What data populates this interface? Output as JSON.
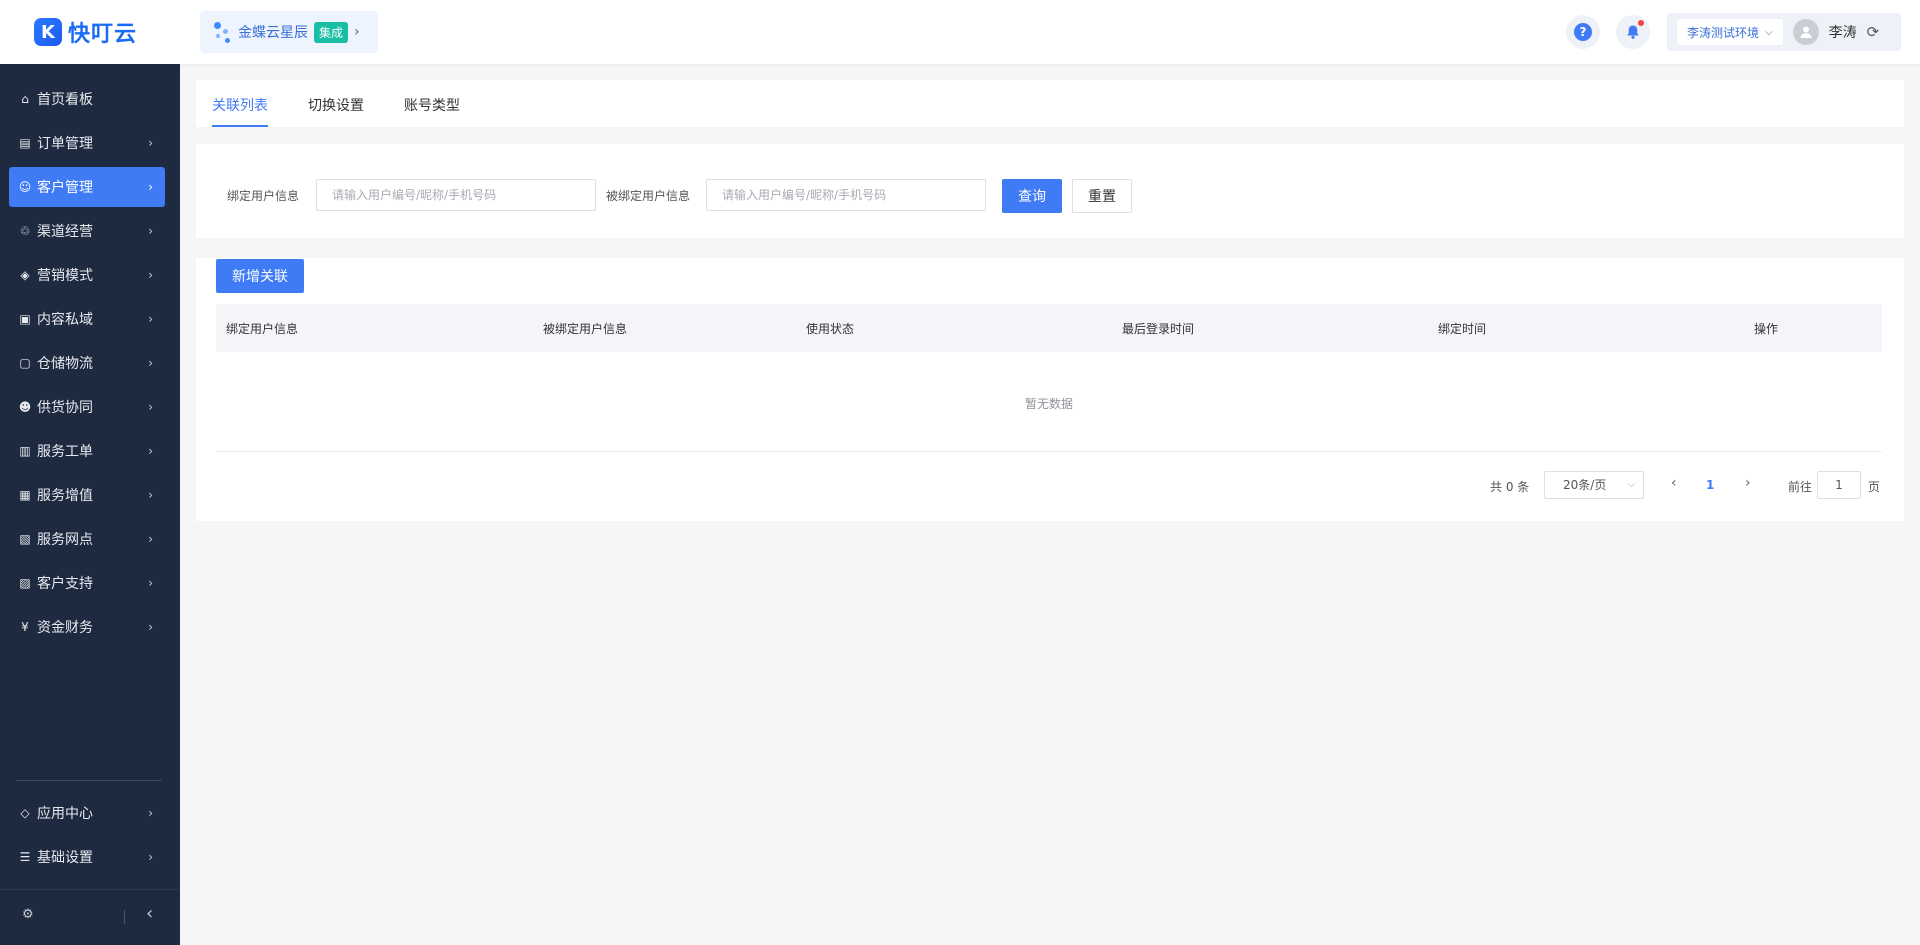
{
  "header": {
    "logo_mark": "K",
    "logo_text": "快叮云",
    "product_name": "金蝶云星辰",
    "product_badge": "集成",
    "help_glyph": "?",
    "env_name": "李涛测试环境",
    "user_name": "李涛"
  },
  "sidebar": {
    "items": [
      {
        "label": "首页看板",
        "icon": "home-icon",
        "glyph": "⌂"
      },
      {
        "label": "订单管理",
        "icon": "clipboard-icon",
        "glyph": "▤"
      },
      {
        "label": "客户管理",
        "icon": "user-icon",
        "glyph": "☺"
      },
      {
        "label": "渠道经营",
        "icon": "channel-icon",
        "glyph": "♲"
      },
      {
        "label": "营销模式",
        "icon": "tag-icon",
        "glyph": "◈"
      },
      {
        "label": "内容私域",
        "icon": "image-icon",
        "glyph": "▣"
      },
      {
        "label": "仓储物流",
        "icon": "box-icon",
        "glyph": "▢"
      },
      {
        "label": "供货协同",
        "icon": "supplier-icon",
        "glyph": "☻"
      },
      {
        "label": "服务工单",
        "icon": "ticket-icon",
        "glyph": "▥"
      },
      {
        "label": "服务增值",
        "icon": "bag-icon",
        "glyph": "▦"
      },
      {
        "label": "服务网点",
        "icon": "store-icon",
        "glyph": "▧"
      },
      {
        "label": "客户支持",
        "icon": "support-icon",
        "glyph": "▨"
      },
      {
        "label": "资金财务",
        "icon": "yen-icon",
        "glyph": "¥"
      }
    ],
    "bottom_items": [
      {
        "label": "应用中心",
        "icon": "cube-icon",
        "glyph": "◇"
      },
      {
        "label": "基础设置",
        "icon": "settings-sliders-icon",
        "glyph": "☰"
      }
    ],
    "active_index": 2,
    "footer_left_glyph": "⚙",
    "footer_right_glyph": "‹"
  },
  "tabs": [
    "关联列表",
    "切换设置",
    "账号类型"
  ],
  "search": {
    "bind_label": "绑定用户信息",
    "bind_placeholder": "请输入用户编号/昵称/手机号码",
    "bound_label": "被绑定用户信息",
    "bound_placeholder": "请输入用户编号/昵称/手机号码",
    "query_label": "查询",
    "reset_label": "重置"
  },
  "table": {
    "add_label": "新增关联",
    "columns": [
      "绑定用户信息",
      "被绑定用户信息",
      "使用状态",
      "最后登录时间",
      "绑定时间",
      "操作"
    ],
    "empty_text": "暂无数据"
  },
  "pagination": {
    "total_text": "共 0 条",
    "page_size": "20条/页",
    "current_page": "1",
    "goto_label": "前往",
    "goto_value": "1",
    "page_suffix": "页"
  },
  "colors": {
    "primary": "#3f7bf5",
    "sidebar_bg": "#1e2a3f",
    "badge": "#19bfa5",
    "notify_dot": "#f5443b"
  }
}
